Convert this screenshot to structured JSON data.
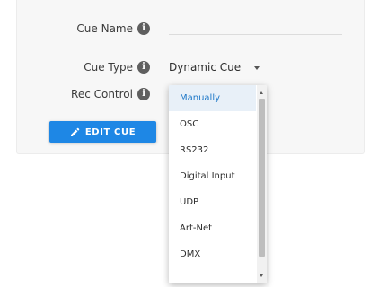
{
  "form": {
    "cue_name_label": "Cue Name",
    "cue_name_value": "",
    "cue_type_label": "Cue Type",
    "cue_type_value": "Dynamic Cue",
    "rec_control_label": "Rec Control",
    "info_icon_glyph": "i"
  },
  "buttons": {
    "edit_cue_label": "EDIT CUE",
    "edit_icon": "pencil-icon"
  },
  "rec_control_dropdown": {
    "selected": "Manually",
    "options": [
      "Manually",
      "OSC",
      "RS232",
      "Digital Input",
      "UDP",
      "Art-Net",
      "DMX"
    ]
  },
  "colors": {
    "accent": "#1e87e5",
    "selected_text": "#1e78c8",
    "selected_bg": "#e8f0f8",
    "card_bg": "#f7f7f7",
    "info_icon": "#5f5f5f"
  }
}
